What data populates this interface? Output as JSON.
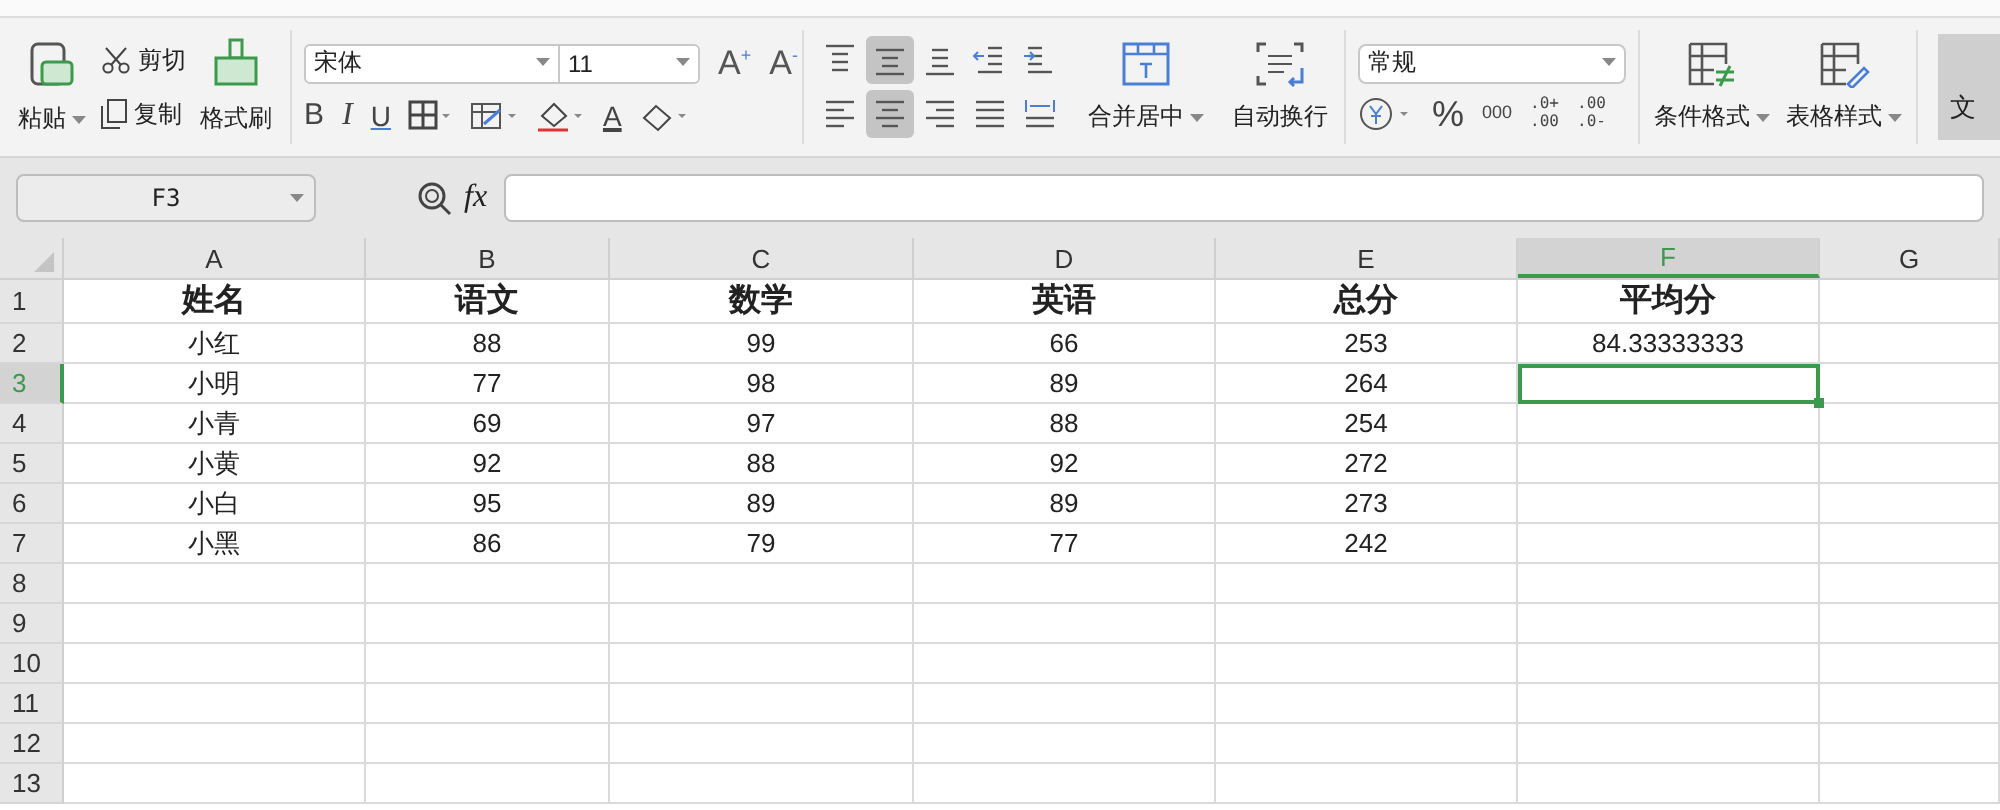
{
  "ribbon": {
    "clipboard": {
      "paste": "粘贴",
      "cut": "剪切",
      "copy": "复制",
      "format_painter": "格式刷"
    },
    "font": {
      "name": "宋体",
      "size": "11",
      "grow": "A$^{+}$",
      "shrink": "A$^{-}$",
      "bold": "B",
      "italic": "I",
      "underline": "U",
      "font_color": "A"
    },
    "alignment": {
      "buttons": [
        {
          "kind": "top",
          "selected": false
        },
        {
          "kind": "middle",
          "selected": true
        },
        {
          "kind": "bottom",
          "selected": false
        },
        {
          "kind": "outdent",
          "selected": false
        },
        {
          "kind": "indent",
          "selected": false
        },
        {
          "kind": "left",
          "selected": false
        },
        {
          "kind": "center",
          "selected": true
        },
        {
          "kind": "right",
          "selected": false
        },
        {
          "kind": "justify",
          "selected": false
        },
        {
          "kind": "distribute",
          "selected": false
        }
      ],
      "merge": "合并居中",
      "wrap": "自动换行"
    },
    "number": {
      "format": "常规",
      "percent": "%",
      "thousands": "000",
      "increase_decimal": [
        ".0+",
        ".00"
      ],
      "decrease_decimal": [
        ".00",
        ".0-"
      ]
    },
    "styles": {
      "conditional": "条件格式",
      "table_style": "表格样式",
      "document": "文"
    }
  },
  "formula_bar": {
    "name_box": "F3",
    "fx": "fx"
  },
  "sheet": {
    "columns": [
      {
        "label": "A",
        "selected": false
      },
      {
        "label": "B",
        "selected": false
      },
      {
        "label": "C",
        "selected": false
      },
      {
        "label": "D",
        "selected": false
      },
      {
        "label": "E",
        "selected": false
      },
      {
        "label": "F",
        "selected": true
      },
      {
        "label": "G",
        "selected": false
      }
    ],
    "rows": [
      {
        "label": "1",
        "selected": false,
        "bold": true,
        "cells": [
          "姓名",
          "语文",
          "数学",
          "英语",
          "总分",
          "平均分"
        ]
      },
      {
        "label": "2",
        "selected": false,
        "bold": false,
        "cells": [
          "小红",
          "88",
          "99",
          "66",
          "253",
          "84.33333333"
        ]
      },
      {
        "label": "3",
        "selected": true,
        "bold": false,
        "cells": [
          "小明",
          "77",
          "98",
          "89",
          "264"
        ]
      },
      {
        "label": "4",
        "selected": false,
        "bold": false,
        "cells": [
          "小青",
          "69",
          "97",
          "88",
          "254"
        ]
      },
      {
        "label": "5",
        "selected": false,
        "bold": false,
        "cells": [
          "小黄",
          "92",
          "88",
          "92",
          "272"
        ]
      },
      {
        "label": "6",
        "selected": false,
        "bold": false,
        "cells": [
          "小白",
          "95",
          "89",
          "89",
          "273"
        ]
      },
      {
        "label": "7",
        "selected": false,
        "bold": false,
        "cells": [
          "小黑",
          "86",
          "79",
          "77",
          "242"
        ]
      },
      {
        "label": "8",
        "selected": false
      },
      {
        "label": "9",
        "selected": false
      },
      {
        "label": "10",
        "selected": false
      },
      {
        "label": "11",
        "selected": false
      },
      {
        "label": "12",
        "selected": false
      },
      {
        "label": "13",
        "selected": false
      }
    ]
  }
}
